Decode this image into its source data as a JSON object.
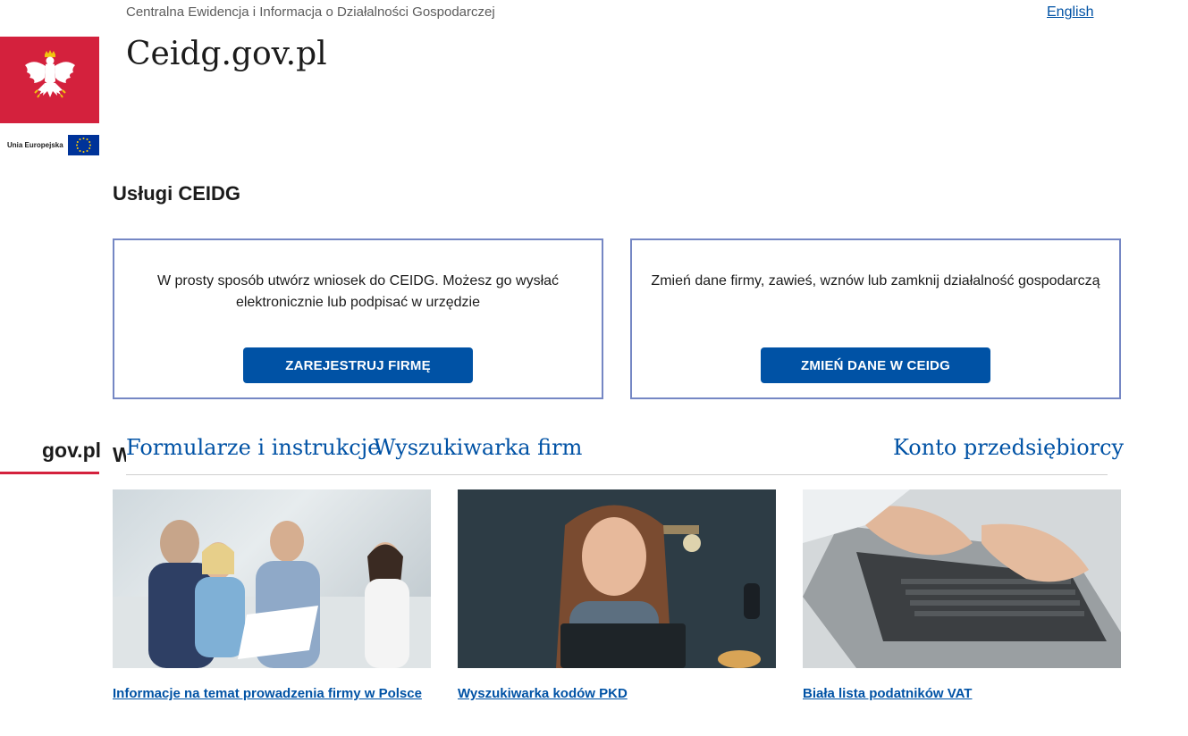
{
  "header": {
    "subtitle": "Centralna Ewidencja i Informacja o Działalności Gospodarczej",
    "language_link": "English",
    "site_title": "Ceidg.gov.pl"
  },
  "branding": {
    "emblem_icon": "polish-eagle-emblem",
    "eu_label": "Unia Europejska",
    "eu_flag_icon": "eu-flag-icon",
    "govpl_label": "gov.pl",
    "accent_red": "#d4213d",
    "brand_blue": "#0052a5"
  },
  "services": {
    "title": "Usługi CEIDG",
    "cards": [
      {
        "text": "W prosty sposób utwórz wniosek do CEIDG. Możesz go wysłać elektronicznie lub podpisać w urzędzie",
        "button": "ZAREJESTRUJ FIRMĘ"
      },
      {
        "text": "Zmień dane firmy, zawieś, wznów lub zamknij działalność gospodarczą",
        "button": "ZMIEŃ DANE W CEIDG"
      }
    ]
  },
  "partially_hidden_heading": "W",
  "tabs": [
    {
      "label": "Formularze i instrukcje"
    },
    {
      "label": "Wyszukiwarka firm"
    },
    {
      "label": "Konto przedsiębiorcy"
    }
  ],
  "tiles": [
    {
      "image": "business-meeting-photo",
      "link": "Informacje na temat prowadzenia firmy w Polsce"
    },
    {
      "image": "woman-laptop-photo",
      "link": "Wyszukiwarka kodów PKD"
    },
    {
      "image": "hands-typing-laptop-photo",
      "link": "Biała lista podatników VAT"
    }
  ]
}
